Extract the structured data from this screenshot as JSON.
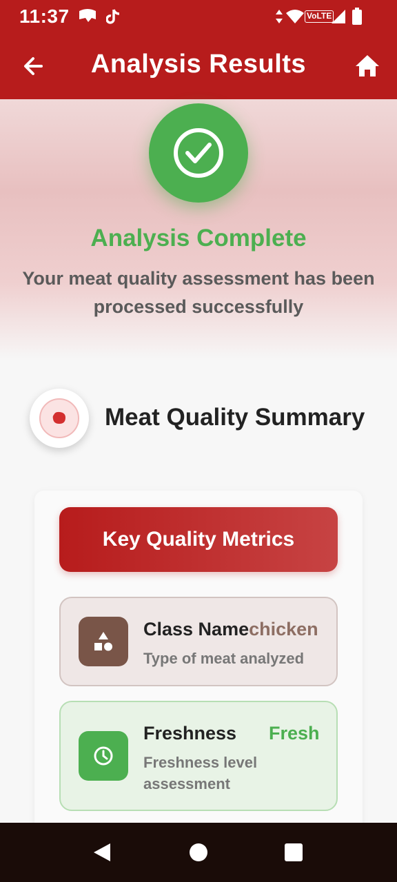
{
  "status_bar": {
    "time": "11:37",
    "network_label": "VoLTE",
    "icons": [
      "chat-app-icon",
      "tiktok-icon",
      "data-arrows-icon",
      "wifi-icon",
      "volte-icon",
      "signal-icon",
      "battery-icon"
    ]
  },
  "app_bar": {
    "title": "Analysis Results",
    "back_icon": "arrow-back-icon",
    "home_icon": "home-icon",
    "color": "#b71c1c"
  },
  "hero": {
    "icon": "check-circle-icon",
    "title": "Analysis Complete",
    "subtitle": "Your meat quality assessment has been processed successfully",
    "title_color": "#4caf50"
  },
  "summary": {
    "icon": "meat-icon",
    "title": "Meat Quality Summary"
  },
  "metrics": {
    "header_label": "Key Quality Metrics",
    "items": [
      {
        "label": "Class Name",
        "value": "chicken",
        "description": "Type of meat analyzed",
        "icon": "category-shapes-icon",
        "color": "#795548"
      },
      {
        "label": "Freshness",
        "value": "Fresh",
        "description": "Freshness level assessment",
        "icon": "clock-icon",
        "color": "#4caf50"
      }
    ]
  },
  "nav_bar": {
    "buttons": [
      "nav-back-icon",
      "nav-home-icon",
      "nav-recents-icon"
    ]
  }
}
